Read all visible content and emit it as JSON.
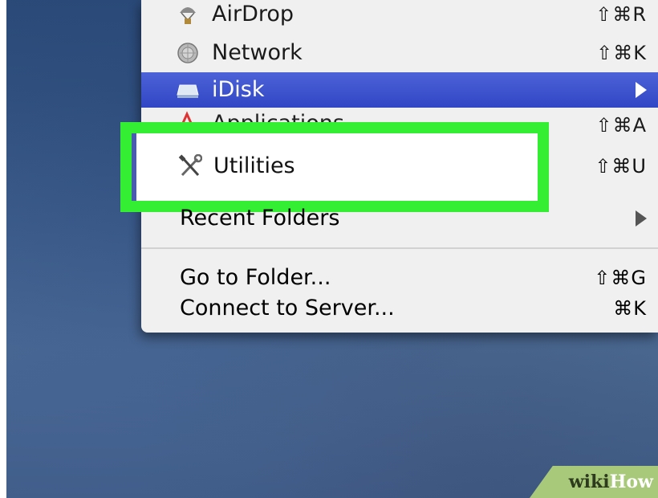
{
  "menu": {
    "items": [
      {
        "label": "AirDrop",
        "shortcut": "⇧⌘R",
        "icon": "airdrop-icon"
      },
      {
        "label": "Network",
        "shortcut": "⇧⌘K",
        "icon": "network-globe-icon"
      },
      {
        "label": "iDisk",
        "shortcut": "",
        "icon": "idisk-icon",
        "submenu": true,
        "selected": true
      },
      {
        "label": "Applications",
        "shortcut": "⇧⌘A",
        "icon": "applications-icon"
      },
      {
        "label": "Utilities",
        "shortcut": "⇧⌘U",
        "icon": "utilities-tools-icon",
        "highlighted": true
      },
      {
        "label": "Recent Folders",
        "shortcut": "",
        "submenu": true
      },
      {
        "label": "Go to Folder...",
        "shortcut": "⇧⌘G"
      },
      {
        "label": "Connect to Server...",
        "shortcut": "⌘K"
      }
    ]
  },
  "highlight_color": "#33ee33",
  "selection_color": "#3a4fcc",
  "watermark": {
    "wiki": "wiki",
    "how": "How"
  }
}
